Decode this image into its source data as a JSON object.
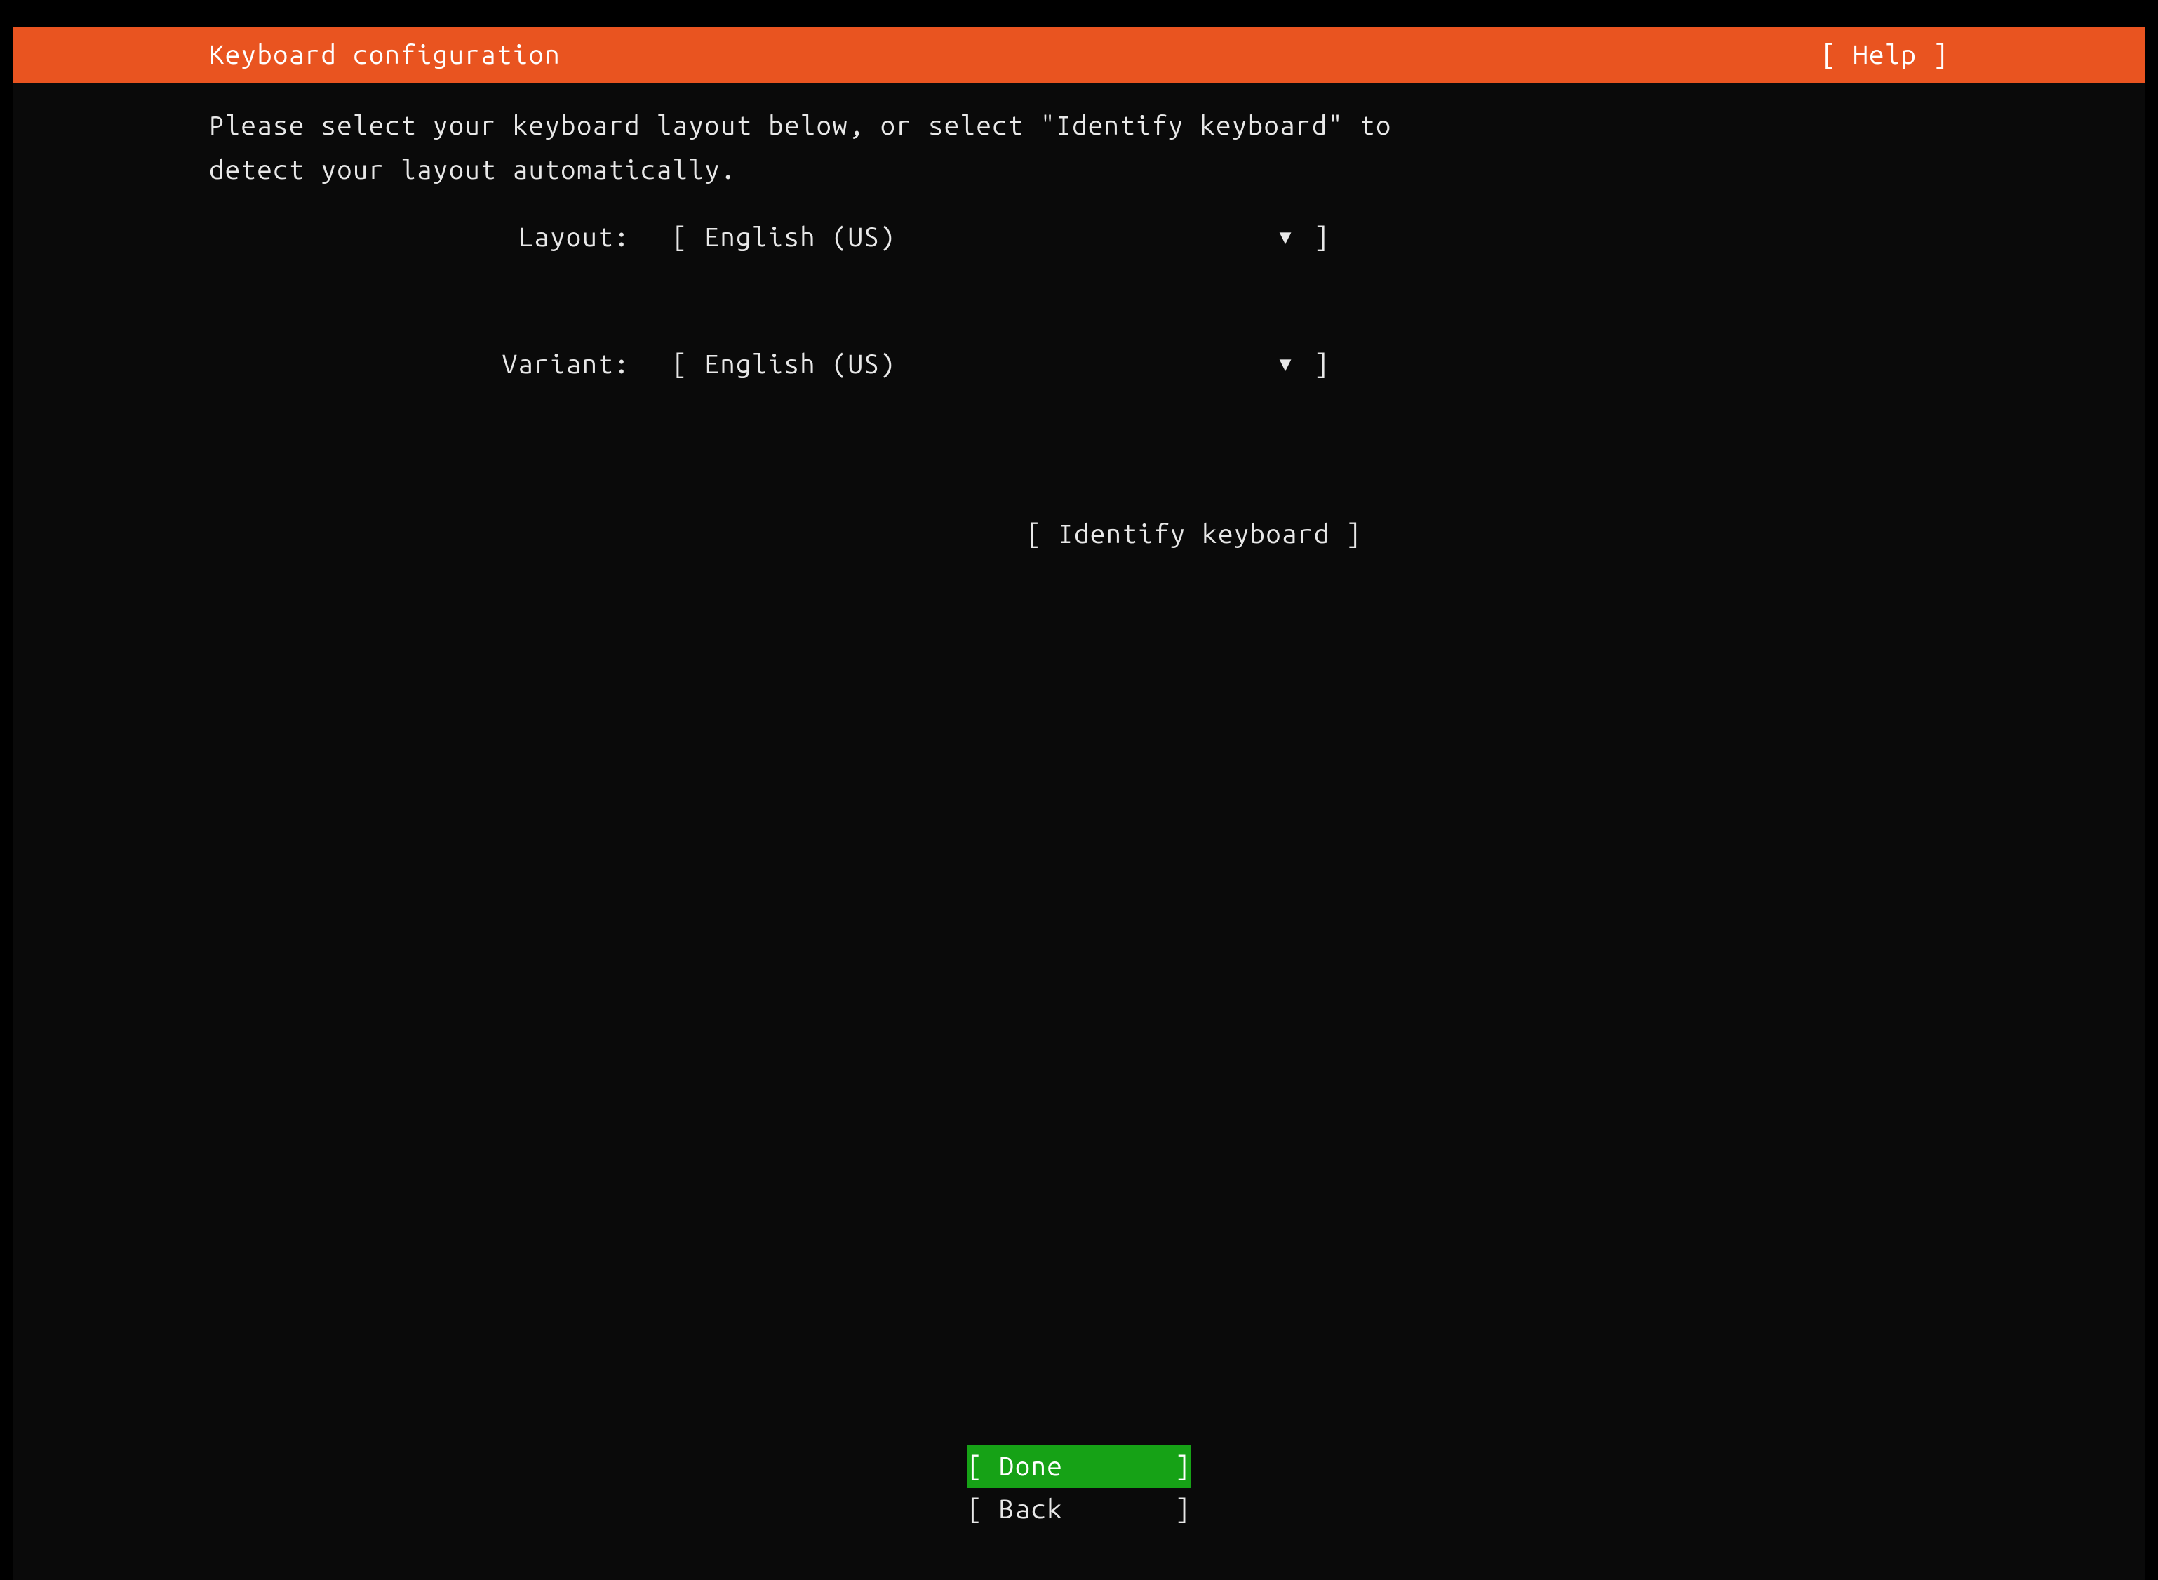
{
  "header": {
    "title": "Keyboard configuration",
    "help": "[ Help ]"
  },
  "instruction": "Please select your keyboard layout below, or select \"Identify keyboard\" to\ndetect your layout automatically.",
  "form": {
    "layout": {
      "label": "Layout:",
      "value": "English (US)"
    },
    "variant": {
      "label": "Variant:",
      "value": "English (US)"
    },
    "identify": "[ Identify keyboard ]"
  },
  "footer": {
    "done": "[ Done       ]",
    "back": "[ Back       ]"
  }
}
